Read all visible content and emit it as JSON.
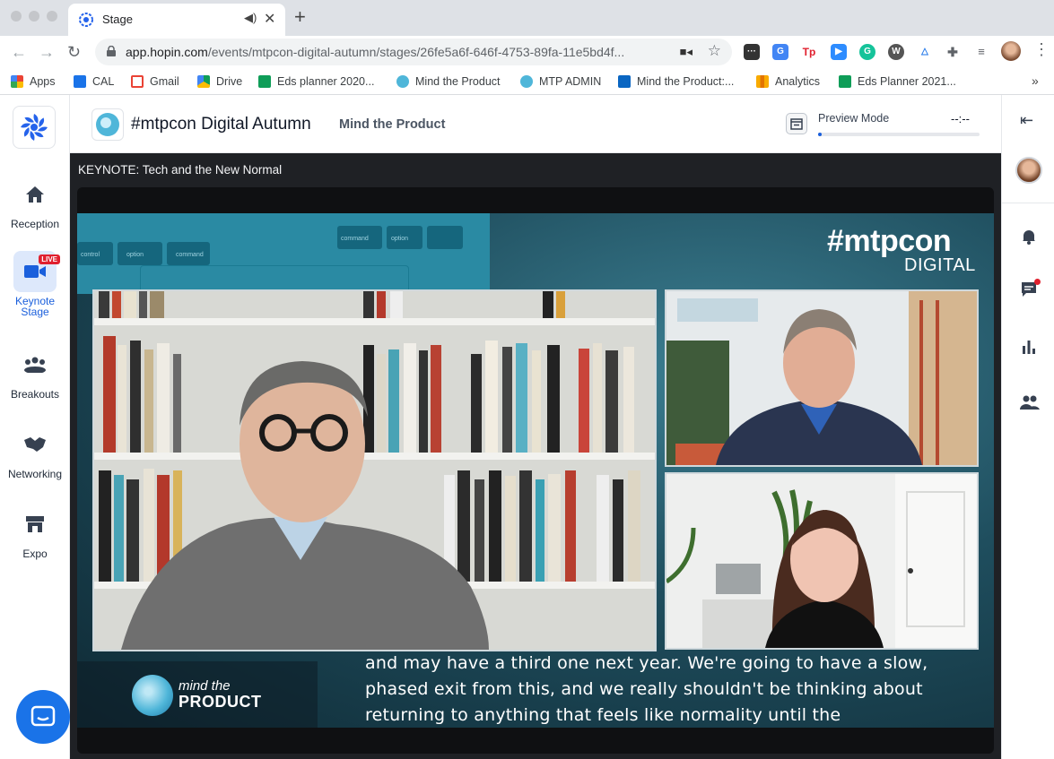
{
  "browser": {
    "tab_title": "Stage",
    "url_host": "app.hopin.com",
    "url_path": "/events/mtpcon-digital-autumn/stages/26fe5a6f-646f-4753-89fa-11e5bd4f...",
    "bookmarks": [
      {
        "label": "Apps",
        "color": "#ea4335"
      },
      {
        "label": "CAL",
        "color": "#1a73e8"
      },
      {
        "label": "Gmail",
        "color": "#ea4335"
      },
      {
        "label": "Drive",
        "color": "#fbbc04"
      },
      {
        "label": "Eds planner 2020...",
        "color": "#0f9d58"
      },
      {
        "label": "Mind the Product",
        "color": "#4fb6d9"
      },
      {
        "label": "MTP ADMIN",
        "color": "#4fb6d9"
      },
      {
        "label": "Mind the Product:...",
        "color": "#0a66c2"
      },
      {
        "label": "Analytics",
        "color": "#f9ab00"
      },
      {
        "label": "Eds Planner 2021...",
        "color": "#0f9d58"
      }
    ],
    "extension_tp_label": "Tp"
  },
  "leftnav": {
    "items": [
      {
        "label": "Reception"
      },
      {
        "label": "Keynote Stage",
        "badge": "LIVE"
      },
      {
        "label": "Breakouts"
      },
      {
        "label": "Networking"
      },
      {
        "label": "Expo"
      }
    ]
  },
  "header": {
    "event_title": "#mtpcon Digital Autumn",
    "organiser": "Mind the Product",
    "preview_label": "Preview Mode",
    "preview_time": "--:--",
    "preview_progress": 0.02
  },
  "stage": {
    "title": "KEYNOTE: Tech and the New Normal",
    "brand_hashtag": "#mtpcon",
    "brand_sub": "DIGITAL",
    "caption_lines": [
      "and may have a third one next year.  We're going to have a slow,",
      "phased exit from this, and we really shouldn't be thinking about",
      "returning to anything that feels like normality until the"
    ],
    "badge_line1": "mind the",
    "badge_line2": "PRODUCT",
    "keyboard_keys": [
      "control",
      "option",
      "command",
      "command",
      "option"
    ]
  },
  "colors": {
    "accent": "#1a5fdc",
    "live": "#e0202e",
    "stage_bg": "#1f2125"
  }
}
